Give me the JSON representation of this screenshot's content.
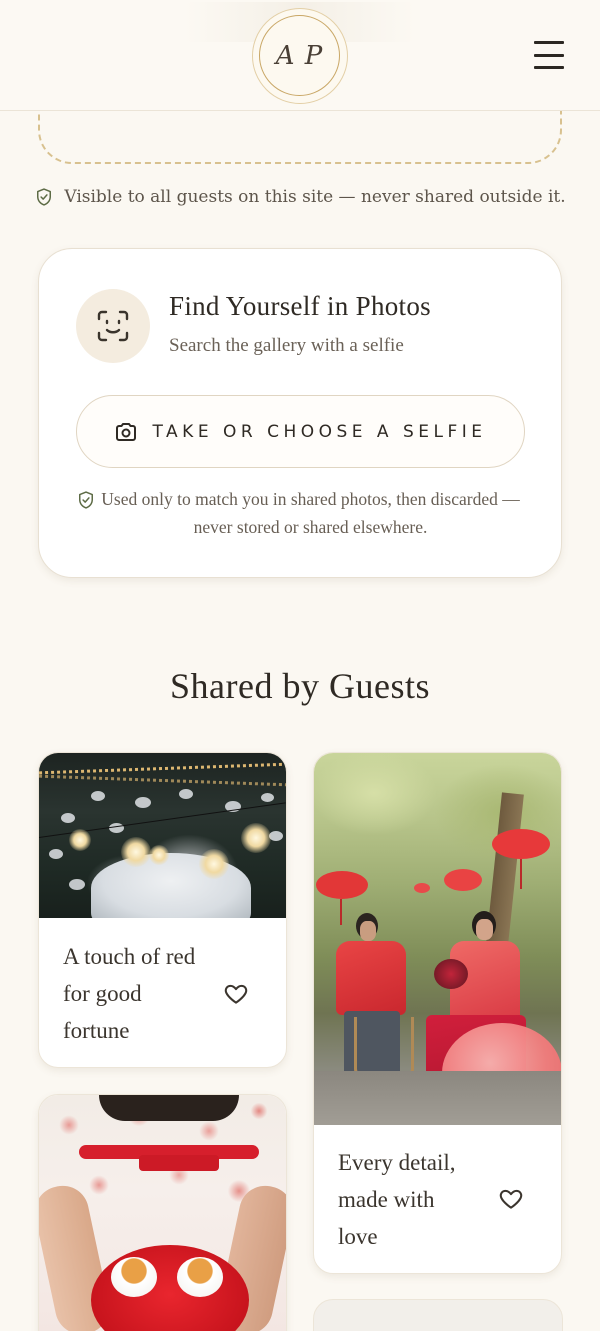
{
  "header": {
    "monogram": "A P",
    "menu_icon": "hamburger-menu-icon"
  },
  "upload": {
    "visibility_note": "Visible to all guests on this site — never shared outside it."
  },
  "find_card": {
    "title": "Find Yourself in Photos",
    "subtitle": "Search the gallery with a selfie",
    "button_label": "TAKE OR CHOOSE A SELFIE",
    "privacy_note": "Used only to match you in shared photos, then discarded — never stored or shared elsewhere."
  },
  "gallery": {
    "title": "Shared by Guests",
    "cards": [
      {
        "caption": "A touch of red for good fortune",
        "image": "string-lights-night-photo"
      },
      {
        "caption": "Every detail, made with love",
        "image": "couple-red-attire-garden-photo"
      },
      {
        "caption": "",
        "image": "tea-cups-red-tray-photo"
      }
    ]
  },
  "colors": {
    "background": "#fbf8f2",
    "gold_accent": "#c9a766",
    "dashed_border": "#d8c18f",
    "text_dark": "#2f2a24",
    "shield_green": "#5d6b45"
  }
}
